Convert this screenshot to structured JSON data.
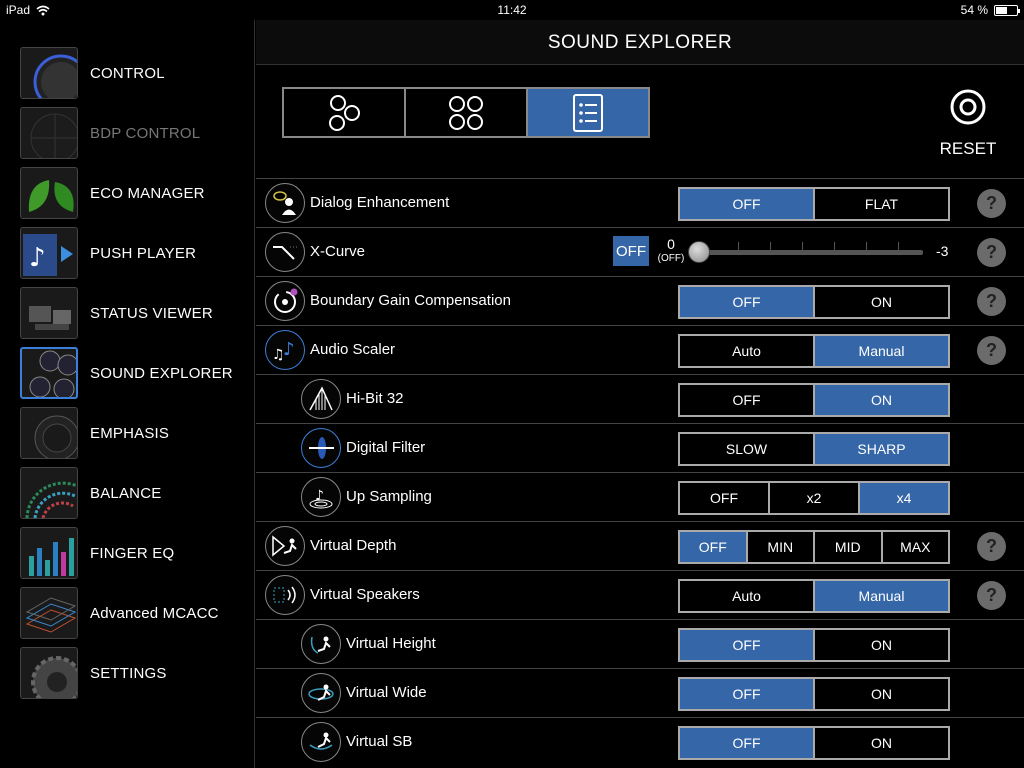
{
  "status": {
    "device": "iPad",
    "time": "11:42",
    "battery": "54 %",
    "battery_fraction": 0.54
  },
  "sidebar": {
    "items": [
      {
        "label": "CONTROL",
        "icon": "knob-icon"
      },
      {
        "label": "BDP CONTROL",
        "icon": "disc-icon",
        "disabled": true
      },
      {
        "label": "ECO MANAGER",
        "icon": "leaf-icon"
      },
      {
        "label": "PUSH PLAYER",
        "icon": "music-note-icon"
      },
      {
        "label": "STATUS VIEWER",
        "icon": "devices-icon"
      },
      {
        "label": "SOUND EXPLORER",
        "icon": "sound-explorer-icon",
        "selected": true
      },
      {
        "label": "EMPHASIS",
        "icon": "speaker-icon"
      },
      {
        "label": "BALANCE",
        "icon": "balance-icon"
      },
      {
        "label": "FINGER EQ",
        "icon": "equalizer-icon"
      },
      {
        "label": "Advanced MCACC",
        "icon": "room-grid-icon"
      },
      {
        "label": "SETTINGS",
        "icon": "gear-icon"
      }
    ]
  },
  "header": {
    "title": "SOUND EXPLORER"
  },
  "toolbar": {
    "reset_label": "RESET"
  },
  "rows": {
    "dialog": {
      "label": "Dialog Enhancement",
      "options": [
        "OFF",
        "FLAT"
      ],
      "selected": 0
    },
    "xcurve": {
      "label": "X-Curve",
      "off_label": "OFF",
      "zero_value": "0",
      "zero_sub": "(OFF)",
      "end_value": "-3"
    },
    "boundary": {
      "label": "Boundary Gain Compensation",
      "options": [
        "OFF",
        "ON"
      ],
      "selected": 0
    },
    "scaler": {
      "label": "Audio Scaler",
      "options": [
        "Auto",
        "Manual"
      ],
      "selected": 1
    },
    "hibit": {
      "label": "Hi-Bit 32",
      "options": [
        "OFF",
        "ON"
      ],
      "selected": 1
    },
    "filter": {
      "label": "Digital Filter",
      "options": [
        "SLOW",
        "SHARP"
      ],
      "selected": 1
    },
    "upsampling": {
      "label": "Up Sampling",
      "options": [
        "OFF",
        "x2",
        "x4"
      ],
      "selected": 2
    },
    "depth": {
      "label": "Virtual Depth",
      "options": [
        "OFF",
        "MIN",
        "MID",
        "MAX"
      ],
      "selected": 0
    },
    "speakers": {
      "label": "Virtual Speakers",
      "options": [
        "Auto",
        "Manual"
      ],
      "selected": 1
    },
    "height": {
      "label": "Virtual Height",
      "options": [
        "OFF",
        "ON"
      ],
      "selected": 0
    },
    "wide": {
      "label": "Virtual Wide",
      "options": [
        "OFF",
        "ON"
      ],
      "selected": 0
    },
    "sb": {
      "label": "Virtual SB",
      "options": [
        "OFF",
        "ON"
      ],
      "selected": 0
    }
  },
  "help_label": "?",
  "colors": {
    "accent": "#3566a8",
    "background": "#000000"
  }
}
